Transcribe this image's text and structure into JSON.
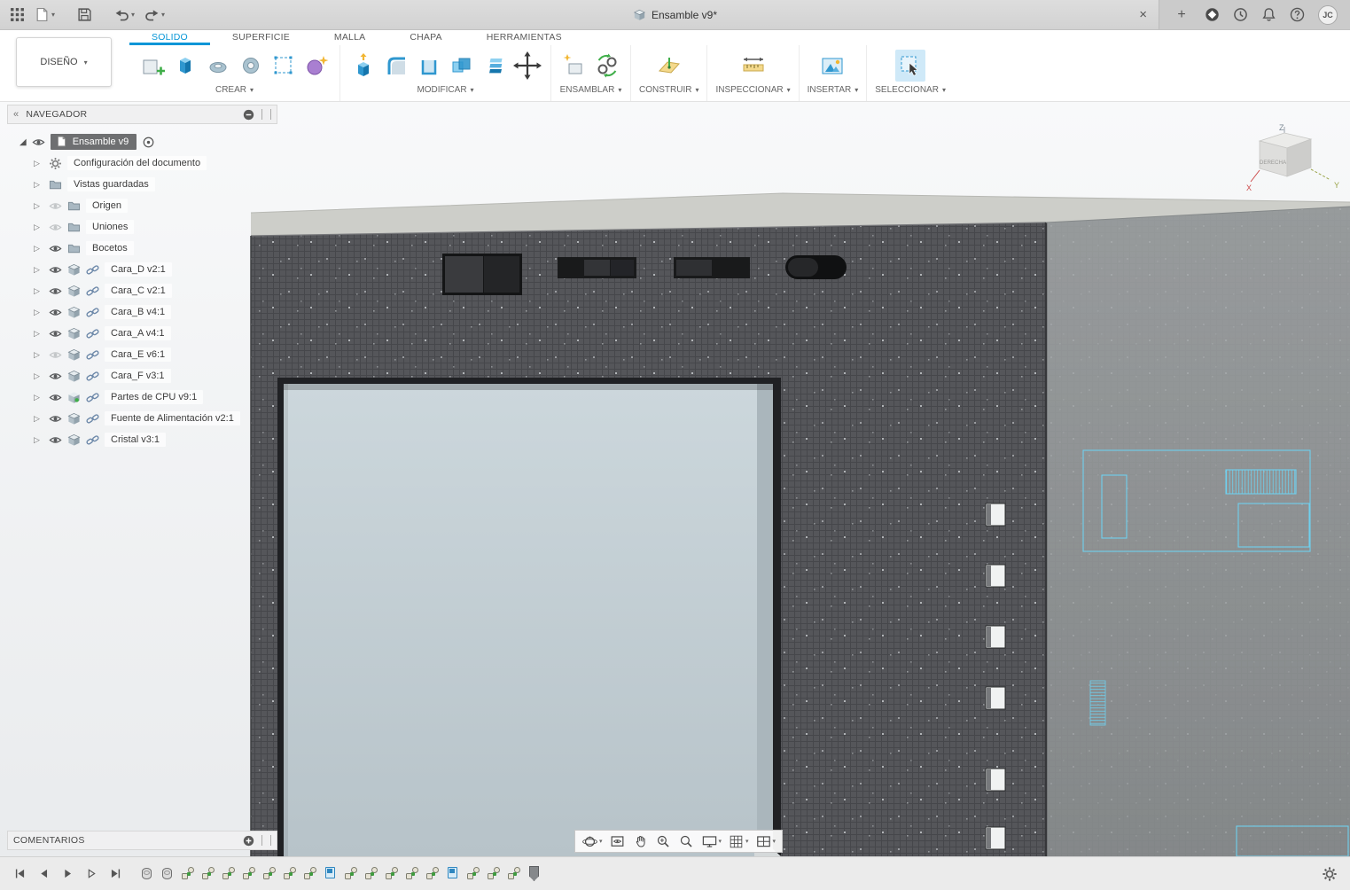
{
  "titlebar": {
    "title": "Ensamble v9*",
    "close_label": "×",
    "new_tab_label": "+",
    "user_initials": "JC",
    "left_icons": [
      "app-grid-icon",
      "file-icon",
      "save-icon",
      "undo-icon",
      "redo-icon"
    ],
    "right_icons": [
      "close-icon",
      "add-tab-icon",
      "extensions-icon",
      "job-status-clock-icon",
      "notifications-bell-icon",
      "help-icon",
      "avatar"
    ]
  },
  "toolbar": {
    "design_label": "DISEÑO",
    "tabs": [
      {
        "label": "SOLIDO",
        "active": true
      },
      {
        "label": "SUPERFICIE",
        "active": false
      },
      {
        "label": "MALLA",
        "active": false
      },
      {
        "label": "CHAPA",
        "active": false
      },
      {
        "label": "HERRAMIENTAS",
        "active": false
      }
    ],
    "groups": [
      {
        "label": "CREAR"
      },
      {
        "label": "MODIFICAR"
      },
      {
        "label": "ENSAMBLAR"
      },
      {
        "label": "CONSTRUIR"
      },
      {
        "label": "INSPECCIONAR"
      },
      {
        "label": "INSERTAR"
      },
      {
        "label": "SELECCIONAR"
      }
    ]
  },
  "navigator": {
    "header": "NAVEGADOR",
    "root_label": "Ensamble v9",
    "items": [
      {
        "label": "Configuración del documento",
        "icon": "gear",
        "eye": "none",
        "link": "false"
      },
      {
        "label": "Vistas guardadas",
        "icon": "folder",
        "eye": "none",
        "link": "false"
      },
      {
        "label": "Origen",
        "icon": "folder",
        "eye": "off",
        "link": "false"
      },
      {
        "label": "Uniones",
        "icon": "folder",
        "eye": "off",
        "link": "false"
      },
      {
        "label": "Bocetos",
        "icon": "folder",
        "eye": "on",
        "link": "false"
      },
      {
        "label": "Cara_D v2:1",
        "icon": "box",
        "eye": "on",
        "link": "true"
      },
      {
        "label": "Cara_C v2:1",
        "icon": "box",
        "eye": "on",
        "link": "true"
      },
      {
        "label": "Cara_B v4:1",
        "icon": "box",
        "eye": "on",
        "link": "true"
      },
      {
        "label": "Cara_A v4:1",
        "icon": "box",
        "eye": "on",
        "link": "true"
      },
      {
        "label": "Cara_E v6:1",
        "icon": "box",
        "eye": "off",
        "link": "true"
      },
      {
        "label": "Cara_F v3:1",
        "icon": "box",
        "eye": "on",
        "link": "true"
      },
      {
        "label": "Partes de CPU v9:1",
        "icon": "cpu",
        "eye": "on",
        "link": "true"
      },
      {
        "label": "Fuente de Alimentación v2:1",
        "icon": "box",
        "eye": "on",
        "link": "true"
      },
      {
        "label": "Cristal v3:1",
        "icon": "box",
        "eye": "on",
        "link": "true"
      }
    ]
  },
  "comments": {
    "header": "COMENTARIOS"
  },
  "viewcube": {
    "face_label": "DERECHA",
    "axis_x": "X",
    "axis_y": "Y",
    "axis_z": "Z"
  },
  "view_nav": {
    "icons": [
      "orbit",
      "look-at",
      "pan",
      "zoom",
      "fit",
      "display-settings",
      "grid-settings",
      "viewports"
    ]
  },
  "timeline": {
    "playback": [
      "go-to-start",
      "step-back",
      "play",
      "step-forward",
      "go-to-end"
    ],
    "items": [
      {
        "type": "cyl"
      },
      {
        "type": "cyl"
      },
      {
        "type": "joint"
      },
      {
        "type": "joint"
      },
      {
        "type": "joint"
      },
      {
        "type": "joint"
      },
      {
        "type": "joint"
      },
      {
        "type": "joint"
      },
      {
        "type": "joint"
      },
      {
        "type": "flag"
      },
      {
        "type": "joint"
      },
      {
        "type": "joint"
      },
      {
        "type": "joint"
      },
      {
        "type": "joint"
      },
      {
        "type": "joint"
      },
      {
        "type": "flag"
      },
      {
        "type": "joint"
      },
      {
        "type": "joint"
      },
      {
        "type": "joint"
      }
    ]
  },
  "colors": {
    "accent_blue": "#0696d7",
    "sketch_cyan": "#6fd0ee",
    "case_front": "#55565a",
    "case_side": "#979b9c",
    "case_top": "#cdcec9",
    "glass": "#c3ced4"
  }
}
